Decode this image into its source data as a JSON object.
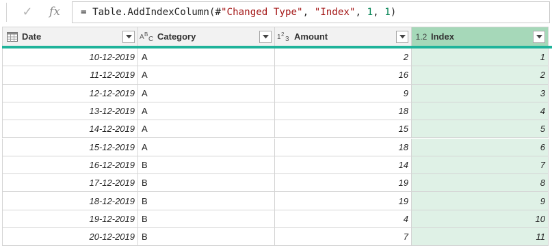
{
  "formula": {
    "prefix": "= Table.AddIndexColumn(#",
    "arg1": "\"Changed Type\"",
    "sep1": ", ",
    "arg2": "\"Index\"",
    "sep2": ", ",
    "arg3": "1",
    "sep3": ", ",
    "arg4": "1",
    "suffix": ")"
  },
  "toolbar": {
    "commit_glyph": "✓",
    "fx_label": "fx"
  },
  "columns": [
    {
      "name": "Date",
      "type_icon": "calendar-icon",
      "type_text": ""
    },
    {
      "name": "Category",
      "type_icon": "text-type-icon",
      "type_text": "ABC"
    },
    {
      "name": "Amount",
      "type_icon": "whole-number-type-icon",
      "type_text": "123"
    },
    {
      "name": "Index",
      "type_icon": "decimal-type-icon",
      "type_text": "1.2"
    }
  ],
  "colors": {
    "selected_header": "#a6d8b9",
    "selected_cells": "#dff1e6",
    "quality_bar": "#1fb39a"
  },
  "rows": [
    {
      "date": "10-12-2019",
      "category": "A",
      "amount": "2",
      "index": "1"
    },
    {
      "date": "11-12-2019",
      "category": "A",
      "amount": "16",
      "index": "2"
    },
    {
      "date": "12-12-2019",
      "category": "A",
      "amount": "9",
      "index": "3"
    },
    {
      "date": "13-12-2019",
      "category": "A",
      "amount": "18",
      "index": "4"
    },
    {
      "date": "14-12-2019",
      "category": "A",
      "amount": "15",
      "index": "5"
    },
    {
      "date": "15-12-2019",
      "category": "A",
      "amount": "18",
      "index": "6"
    },
    {
      "date": "16-12-2019",
      "category": "B",
      "amount": "14",
      "index": "7"
    },
    {
      "date": "17-12-2019",
      "category": "B",
      "amount": "19",
      "index": "8"
    },
    {
      "date": "18-12-2019",
      "category": "B",
      "amount": "19",
      "index": "9"
    },
    {
      "date": "19-12-2019",
      "category": "B",
      "amount": "4",
      "index": "10"
    },
    {
      "date": "20-12-2019",
      "category": "B",
      "amount": "7",
      "index": "11"
    }
  ]
}
